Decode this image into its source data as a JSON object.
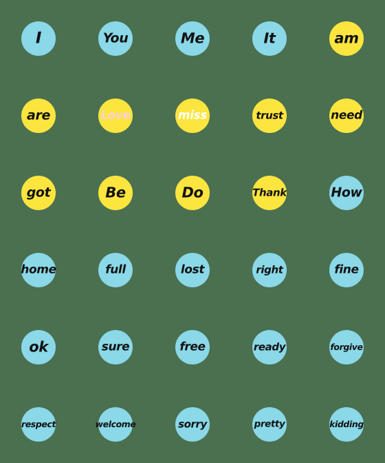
{
  "sheet": {
    "background_color": "#4a7050",
    "columns": 5,
    "rows": 6,
    "cell_size": 112,
    "bubble_diameter": 50,
    "palette": {
      "blue": "#8ad8e8",
      "yellow": "#fde53f",
      "ink_black": "#121212",
      "ink_white": "#ffffff",
      "ink_pink": "#f7d2d6"
    }
  },
  "stickers": [
    {
      "word": "I",
      "shape": "circle",
      "fill": "blue",
      "ink": "black",
      "row": 1,
      "col": 1
    },
    {
      "word": "You",
      "shape": "circle",
      "fill": "blue",
      "ink": "black",
      "row": 1,
      "col": 2
    },
    {
      "word": "Me",
      "shape": "circle",
      "fill": "blue",
      "ink": "black",
      "row": 1,
      "col": 3
    },
    {
      "word": "It",
      "shape": "circle",
      "fill": "blue",
      "ink": "black",
      "row": 1,
      "col": 4
    },
    {
      "word": "am",
      "shape": "circle",
      "fill": "yellow",
      "ink": "black",
      "row": 1,
      "col": 5
    },
    {
      "word": "are",
      "shape": "circle",
      "fill": "yellow",
      "ink": "black",
      "row": 2,
      "col": 1
    },
    {
      "word": "Love",
      "shape": "circle",
      "fill": "yellow",
      "ink": "pink",
      "row": 2,
      "col": 2
    },
    {
      "word": "miss",
      "shape": "circle",
      "fill": "yellow",
      "ink": "white",
      "row": 2,
      "col": 3
    },
    {
      "word": "trust",
      "shape": "circle",
      "fill": "yellow",
      "ink": "black",
      "row": 2,
      "col": 4
    },
    {
      "word": "need",
      "shape": "circle",
      "fill": "yellow",
      "ink": "black",
      "row": 2,
      "col": 5
    },
    {
      "word": "got",
      "shape": "circle",
      "fill": "yellow",
      "ink": "black",
      "row": 3,
      "col": 1
    },
    {
      "word": "Be",
      "shape": "circle",
      "fill": "yellow",
      "ink": "black",
      "row": 3,
      "col": 2
    },
    {
      "word": "Do",
      "shape": "circle",
      "fill": "yellow",
      "ink": "black",
      "row": 3,
      "col": 3
    },
    {
      "word": "Thank",
      "shape": "circle",
      "fill": "yellow",
      "ink": "black",
      "row": 3,
      "col": 4
    },
    {
      "word": "How",
      "shape": "circle",
      "fill": "blue",
      "ink": "black",
      "row": 3,
      "col": 5
    },
    {
      "word": "home",
      "shape": "circle",
      "fill": "blue",
      "ink": "black",
      "row": 4,
      "col": 1
    },
    {
      "word": "full",
      "shape": "circle",
      "fill": "blue",
      "ink": "black",
      "row": 4,
      "col": 2
    },
    {
      "word": "lost",
      "shape": "circle",
      "fill": "blue",
      "ink": "black",
      "row": 4,
      "col": 3
    },
    {
      "word": "right",
      "shape": "circle",
      "fill": "blue",
      "ink": "black",
      "row": 4,
      "col": 4
    },
    {
      "word": "fine",
      "shape": "circle",
      "fill": "blue",
      "ink": "black",
      "row": 4,
      "col": 5
    },
    {
      "word": "ok",
      "shape": "circle",
      "fill": "blue",
      "ink": "black",
      "row": 5,
      "col": 1
    },
    {
      "word": "sure",
      "shape": "circle",
      "fill": "blue",
      "ink": "black",
      "row": 5,
      "col": 2
    },
    {
      "word": "free",
      "shape": "circle",
      "fill": "blue",
      "ink": "black",
      "row": 5,
      "col": 3
    },
    {
      "word": "ready",
      "shape": "circle",
      "fill": "blue",
      "ink": "black",
      "row": 5,
      "col": 4
    },
    {
      "word": "forgive",
      "shape": "circle",
      "fill": "blue",
      "ink": "black",
      "row": 5,
      "col": 5
    },
    {
      "word": "respect",
      "shape": "circle",
      "fill": "blue",
      "ink": "black",
      "row": 6,
      "col": 1
    },
    {
      "word": "welcome",
      "shape": "circle",
      "fill": "blue",
      "ink": "black",
      "row": 6,
      "col": 2
    },
    {
      "word": "sorry",
      "shape": "circle",
      "fill": "blue",
      "ink": "black",
      "row": 6,
      "col": 3
    },
    {
      "word": "pretty",
      "shape": "circle",
      "fill": "blue",
      "ink": "black",
      "row": 6,
      "col": 4
    },
    {
      "word": "kidding",
      "shape": "circle",
      "fill": "blue",
      "ink": "black",
      "row": 6,
      "col": 5
    }
  ]
}
